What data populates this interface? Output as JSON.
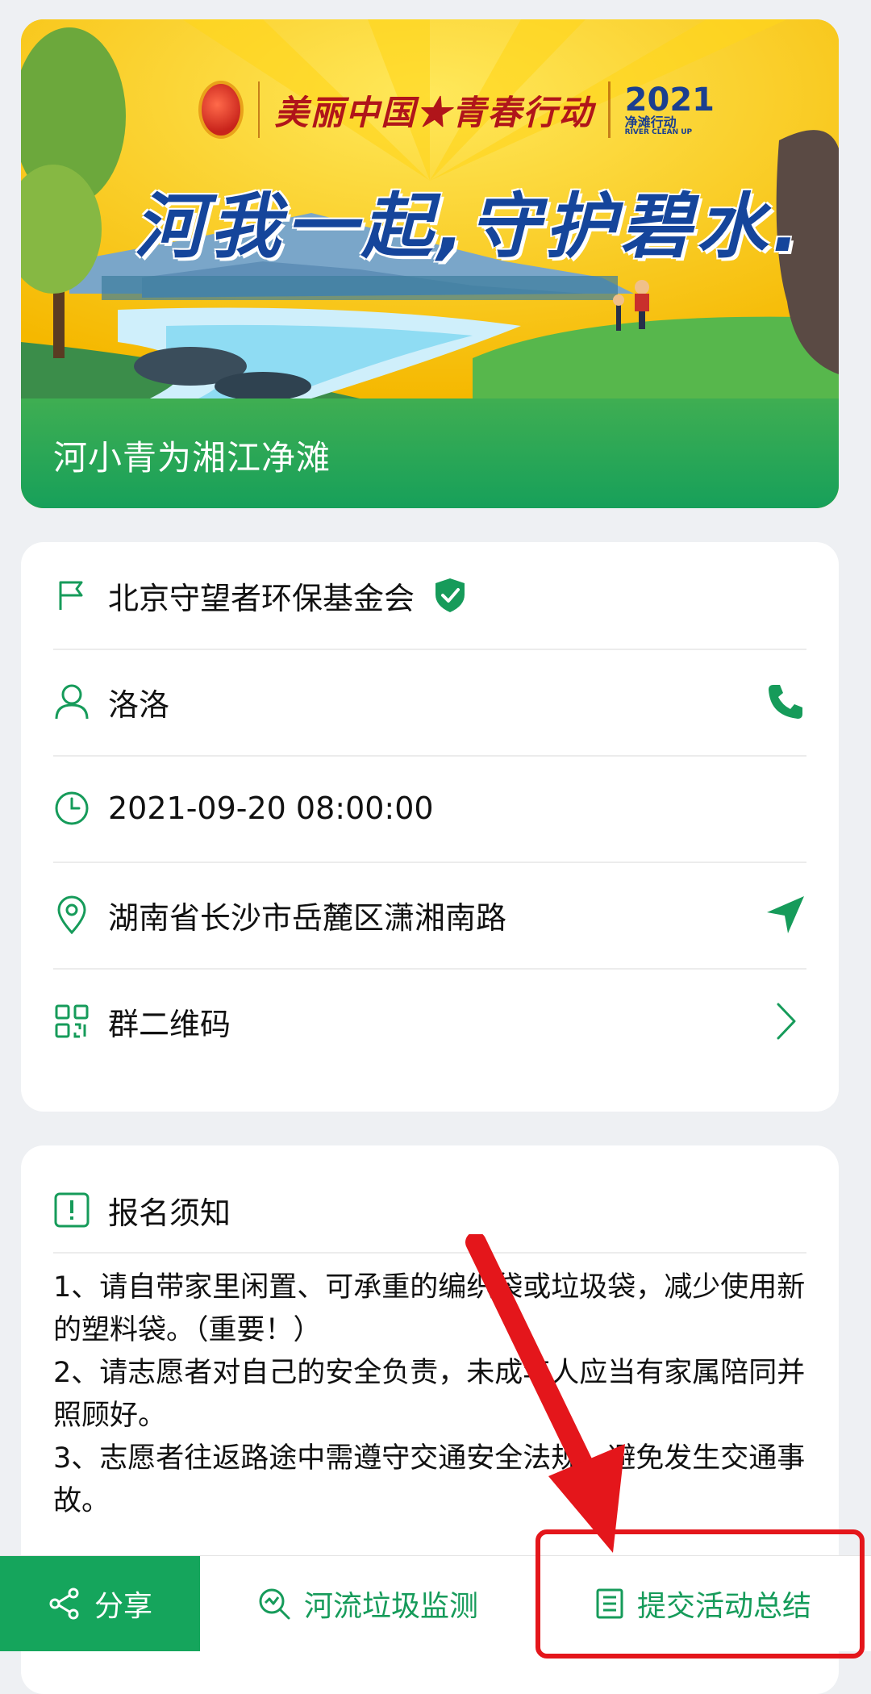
{
  "banner": {
    "logo_text": "美丽中国★青春行动",
    "logo_year": "2021",
    "logo_brand": "净滩行动",
    "logo_brand_en": "RIVER CLEAN UP",
    "headline": "河我一起,守护碧水.",
    "title": "河小青为湘江净滩"
  },
  "info": {
    "organizer": "北京守望者环保基金会",
    "contact": "洛洛",
    "datetime": "2021-09-20 08:00:00",
    "address": "湖南省长沙市岳麓区潇湘南路",
    "qrcode_label": "群二维码"
  },
  "notice": {
    "title": "报名须知",
    "items": [
      "1、请自带家里闲置、可承重的编织袋或垃圾袋，减少使用新的塑料袋。（重要！）",
      "2、请志愿者对自己的安全负责，未成年人应当有家属陪同并照顾好。",
      "3、志愿者往返路途中需遵守交通安全法规，避免发生交通事故。"
    ]
  },
  "bottom_bar": {
    "share": "分享",
    "monitor": "河流垃圾监测",
    "summary": "提交活动总结"
  },
  "colors": {
    "brand_green": "#15a55c",
    "annotation_red": "#e4161b"
  }
}
